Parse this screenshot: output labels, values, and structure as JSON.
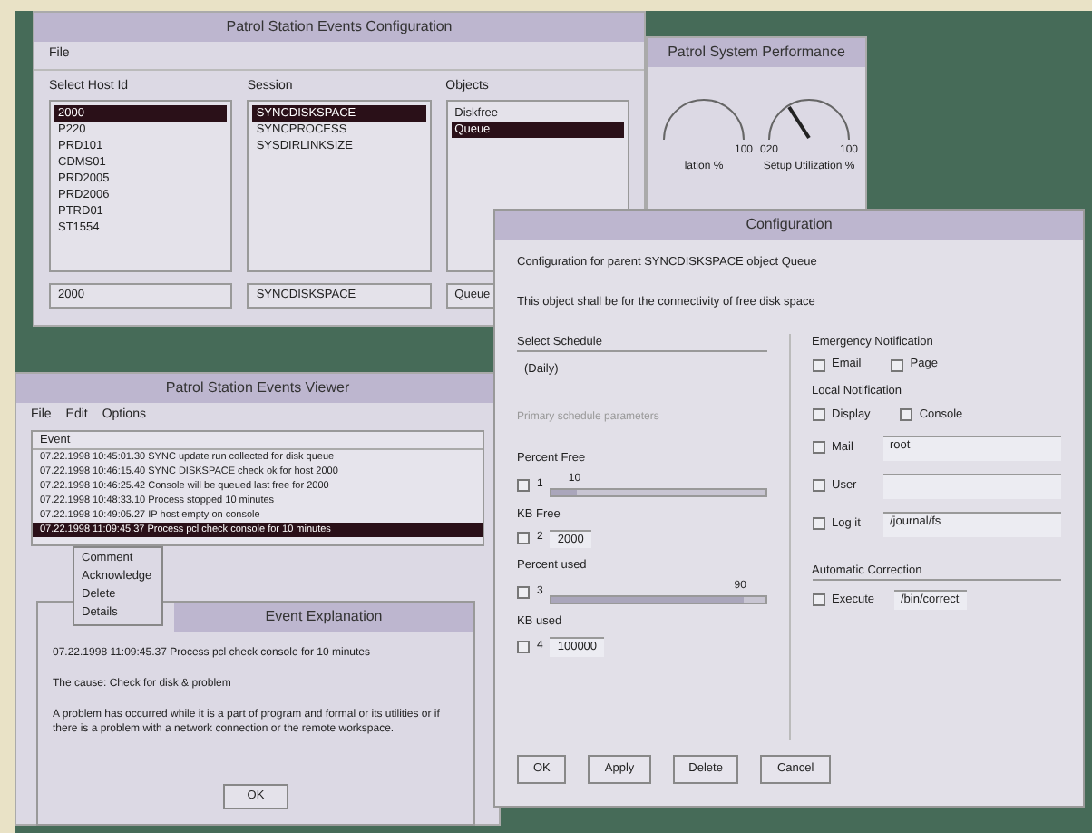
{
  "config_window": {
    "title": "Patrol Station Events Configuration",
    "menu": [
      "File"
    ],
    "lists": [
      {
        "label": "Select Host Id",
        "items": [
          {
            "text": "2000",
            "selected": true
          },
          {
            "text": "P220",
            "selected": false
          },
          {
            "text": "PRD101",
            "selected": false
          },
          {
            "text": "CDMS01",
            "selected": false
          },
          {
            "text": "PRD2005",
            "selected": false
          },
          {
            "text": "PRD2006",
            "selected": false
          },
          {
            "text": "PTRD01",
            "selected": false
          },
          {
            "text": "ST1554",
            "selected": false
          }
        ],
        "value": "2000"
      },
      {
        "label": "Session",
        "items": [
          {
            "text": "SYNCDISKSPACE",
            "selected": true
          },
          {
            "text": "SYNCPROCESS",
            "selected": false
          },
          {
            "text": "SYSDIRLINKSIZE",
            "selected": false
          }
        ],
        "value": "SYNCDISKSPACE"
      },
      {
        "label": "Objects",
        "items": [
          {
            "text": "Diskfree",
            "selected": false
          },
          {
            "text": "Queue",
            "selected": true
          }
        ],
        "value": "Queue"
      }
    ]
  },
  "performance_window": {
    "title": "Patrol System Performance",
    "gauges": [
      {
        "max": "100",
        "label": "lation %"
      },
      {
        "min": "0",
        "mid": "20",
        "max": "100",
        "label": "Setup Utilization %"
      }
    ]
  },
  "events_window": {
    "title": "Patrol Station Events Viewer",
    "menu": [
      "File",
      "Edit",
      "Options"
    ],
    "column": "Event",
    "rows": [
      {
        "text": "07.22.1998 10:45:01.30  SYNC update run collected for disk queue",
        "selected": false
      },
      {
        "text": "07.22.1998 10:46:15.40  SYNC DISKSPACE check ok for host 2000",
        "selected": false
      },
      {
        "text": "07.22.1998 10:46:25.42  Console will be queued  last free for 2000",
        "selected": false
      },
      {
        "text": "07.22.1998 10:48:33.10  Process stopped  10 minutes",
        "selected": false
      },
      {
        "text": "07.22.1998 10:49:05.27  IP host empty on console",
        "selected": false
      },
      {
        "text": "07.22.1998 11:09:45.37  Process pcl check console for 10 minutes",
        "selected": true
      }
    ],
    "context_menu": [
      "Comment",
      "Acknowledge",
      "Delete",
      "Details"
    ]
  },
  "explanation_dialog": {
    "title": "Event Explanation",
    "event": "07.22.1998 11:09:45.37  Process pcl check console for 10 minutes",
    "cause": "The cause: Check for disk & problem",
    "description": "A problem has occurred while it is a part of program and formal or its utilities or if there is a problem with a network connection or the remote workspace.",
    "button": "OK"
  },
  "configuration_dialog": {
    "title": "Configuration",
    "intro": "Configuration for parent SYNCDISKSPACE object Queue",
    "note": "This object shall be for the connectivity of free disk space",
    "schedule": {
      "label": "Select Schedule",
      "value": "(Daily)",
      "disabled_label": "Primary schedule parameters"
    },
    "thresholds": [
      {
        "kind": "slider",
        "label": "Percent Free",
        "index": "1",
        "checked": false,
        "level": 0.12,
        "reading": "10"
      },
      {
        "kind": "field",
        "label": "KB Free",
        "index": "2",
        "checked": false,
        "value": "2000"
      },
      {
        "kind": "slider",
        "label": "Percent used",
        "index": "3",
        "checked": false,
        "level": 0.9,
        "reading": "90"
      },
      {
        "kind": "field",
        "label": "KB used",
        "index": "4",
        "checked": false,
        "value": "100000"
      }
    ],
    "emergency": {
      "label": "Emergency Notification",
      "options": [
        {
          "text": "Email",
          "checked": false
        },
        {
          "text": "Page",
          "checked": false
        }
      ]
    },
    "local": {
      "label": "Local Notification",
      "options": [
        {
          "text": "Display",
          "checked": false
        },
        {
          "text": "Console",
          "checked": false
        }
      ],
      "fields": [
        {
          "label": "Mail",
          "checked": false,
          "value": "root"
        },
        {
          "label": "User",
          "checked": false
        },
        {
          "label": "Log it",
          "checked": false,
          "value": "/journal/fs"
        }
      ]
    },
    "correction": {
      "label": "Automatic Correction",
      "option": {
        "text": "Execute",
        "checked": false
      },
      "value": "/bin/correct"
    },
    "buttons": [
      "OK",
      "Apply",
      "Delete",
      "Cancel"
    ]
  }
}
